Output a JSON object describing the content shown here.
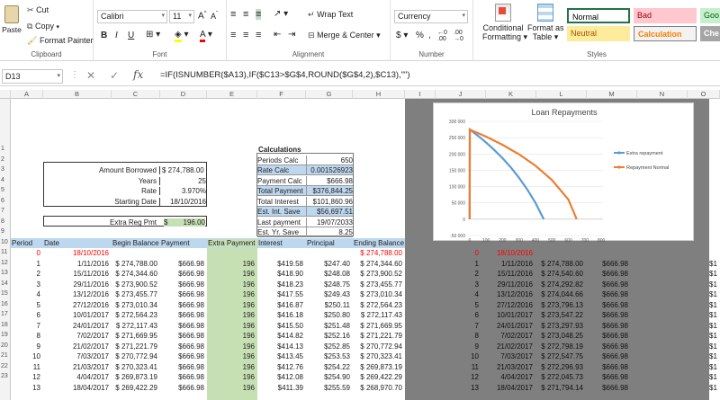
{
  "ribbon": {
    "clipboard": {
      "paste": "Paste",
      "cut": "Cut",
      "copy": "Copy",
      "format_painter": "Format Painter",
      "label": "Clipboard"
    },
    "font": {
      "name": "Calibri",
      "size": "11",
      "label": "Font"
    },
    "alignment": {
      "wrap": "Wrap Text",
      "merge": "Merge & Center",
      "label": "Alignment"
    },
    "number": {
      "format": "Currency",
      "label": "Number"
    },
    "styles": {
      "conditional": "Conditional",
      "conditional2": "Formatting",
      "format_as": "Format as",
      "format_as2": "Table",
      "normal": "Normal",
      "bad": "Bad",
      "good": "Goo",
      "neutral": "Neutral",
      "calculation": "Calculation",
      "check": "Che",
      "label": "Styles"
    }
  },
  "formula_bar": {
    "name_box": "D13",
    "formula": "=IF(ISNUMBER($A13),IF($C13>$G$4,ROUND($G$4,2),$C13),\"\")"
  },
  "columns": [
    "A",
    "B",
    "C",
    "D",
    "E",
    "F",
    "G",
    "H",
    "I",
    "J",
    "K",
    "L",
    "M",
    "N",
    "O"
  ],
  "rows": [
    "1",
    "2",
    "3",
    "4",
    "5",
    "6",
    "7",
    "8",
    "9",
    "10",
    "11",
    "12",
    "13",
    "14",
    "15",
    "16",
    "17",
    "18",
    "19",
    "20",
    "21",
    "22",
    "23"
  ],
  "inputs": [
    {
      "label": "Amount Borrowed",
      "value": "$ 274,788.00"
    },
    {
      "label": "Years",
      "value": "25"
    },
    {
      "label": "Rate",
      "value": "3.970%"
    },
    {
      "label": "Starting Date",
      "value": "18/10/2016"
    }
  ],
  "extra_reg_pmt": {
    "label": "Extra Reg Pmt",
    "currency": "$",
    "value": "196.00"
  },
  "calculations": {
    "title": "Calculations",
    "rows": [
      {
        "label": "Periods Calc",
        "value": "650"
      },
      {
        "label": "Rate Calc",
        "value": "0.001526923"
      },
      {
        "label": "Payment Calc",
        "value": "$666.98"
      },
      {
        "label": "Total Payment",
        "value": "$376,844.25"
      },
      {
        "label": "Total Interest",
        "value": "$101,860.96"
      },
      {
        "label": "Est. Int. Save",
        "value": "$56,697.51"
      },
      {
        "label": "Last payment",
        "value": "19/07/2033"
      },
      {
        "label": "Est. Yr. Save",
        "value": "8.25"
      }
    ]
  },
  "table_headers": [
    "Period",
    "Date",
    "Begin Balance",
    "Payment",
    "Extra Payment",
    "Interest",
    "Principal",
    "Ending Balance"
  ],
  "table": [
    [
      "0",
      "18/10/2016",
      "",
      "",
      "",
      "",
      "",
      "$ 274,788.00"
    ],
    [
      "1",
      "1/11/2016",
      "$ 274,788.00",
      "$666.98",
      "196",
      "$419.58",
      "$247.40",
      "$ 274,344.60"
    ],
    [
      "2",
      "15/11/2016",
      "$ 274,344.60",
      "$666.98",
      "196",
      "$418.90",
      "$248.08",
      "$ 273,900.52"
    ],
    [
      "3",
      "29/11/2016",
      "$ 273,900.52",
      "$666.98",
      "196",
      "$418.23",
      "$248.75",
      "$ 273,455.77"
    ],
    [
      "4",
      "13/12/2016",
      "$ 273,455.77",
      "$666.98",
      "196",
      "$417.55",
      "$249.43",
      "$ 273,010.34"
    ],
    [
      "5",
      "27/12/2016",
      "$ 273,010.34",
      "$666.98",
      "196",
      "$416.87",
      "$250.11",
      "$ 272,564.23"
    ],
    [
      "6",
      "10/01/2017",
      "$ 272,564.23",
      "$666.98",
      "196",
      "$416.18",
      "$250.80",
      "$ 272,117.43"
    ],
    [
      "7",
      "24/01/2017",
      "$ 272,117.43",
      "$666.98",
      "196",
      "$415.50",
      "$251.48",
      "$ 271,669.95"
    ],
    [
      "8",
      "7/02/2017",
      "$ 271,669.95",
      "$666.98",
      "196",
      "$414.82",
      "$252.16",
      "$ 271,221.79"
    ],
    [
      "9",
      "21/02/2017",
      "$ 271,221.79",
      "$666.98",
      "196",
      "$414.13",
      "$252.85",
      "$ 270,772.94"
    ],
    [
      "10",
      "7/03/2017",
      "$ 270,772.94",
      "$666.98",
      "196",
      "$413.45",
      "$253.53",
      "$ 270,323.41"
    ],
    [
      "11",
      "21/03/2017",
      "$ 270,323.41",
      "$666.98",
      "196",
      "$412.76",
      "$254.22",
      "$ 269,873.19"
    ],
    [
      "12",
      "4/04/2017",
      "$ 269,873.19",
      "$666.98",
      "196",
      "$412.08",
      "$254.90",
      "$ 269,422.29"
    ],
    [
      "13",
      "18/04/2017",
      "$ 269,422.29",
      "$666.98",
      "196",
      "$411.39",
      "$255.59",
      "$ 268,970.70"
    ]
  ],
  "table2": [
    [
      "0",
      "18/10/2016",
      "",
      ""
    ],
    [
      "1",
      "1/11/2016",
      "$ 274,788.00",
      "$666.98"
    ],
    [
      "2",
      "15/11/2016",
      "$ 274,540.60",
      "$666.98"
    ],
    [
      "3",
      "29/11/2016",
      "$ 274,292.82",
      "$666.98"
    ],
    [
      "4",
      "13/12/2016",
      "$ 274,044.66",
      "$666.98"
    ],
    [
      "5",
      "27/12/2016",
      "$ 273,796.13",
      "$666.98"
    ],
    [
      "6",
      "10/01/2017",
      "$ 273,547.22",
      "$666.98"
    ],
    [
      "7",
      "24/01/2017",
      "$ 273,297.93",
      "$666.98"
    ],
    [
      "8",
      "7/02/2017",
      "$ 273,048.25",
      "$666.98"
    ],
    [
      "9",
      "21/02/2017",
      "$ 272,798.19",
      "$666.98"
    ],
    [
      "10",
      "7/03/2017",
      "$ 272,547.75",
      "$666.98"
    ],
    [
      "11",
      "21/03/2017",
      "$ 272,296.93",
      "$666.98"
    ],
    [
      "12",
      "4/04/2017",
      "$ 272,045.73",
      "$666.98"
    ],
    [
      "13",
      "18/04/2017",
      "$ 271,794.14",
      "$666.98"
    ]
  ],
  "table2_extra": [
    "$1",
    "$1",
    "$1",
    "$1",
    "$1",
    "$1",
    "$1",
    "$1",
    "$1",
    "$1",
    "$1",
    "$1",
    "$1"
  ],
  "colors": {
    "accent_green": "#217346",
    "extra_fill": "#c6e0b4",
    "header_fill": "#bdd7ee",
    "calc_fill": "#ddebf7",
    "red": "#ff0000",
    "series_extra": "#5b9bd5",
    "series_normal": "#ed7d31"
  },
  "chart_data": {
    "type": "line",
    "title": "Loan Repayments",
    "xlim": [
      -10,
      810
    ],
    "ylim": [
      -50000,
      300000
    ],
    "x_ticks": [
      0,
      100,
      200,
      300,
      400,
      500,
      600,
      700,
      800
    ],
    "y_ticks": [
      -50000,
      0,
      50000,
      100000,
      150000,
      200000,
      250000,
      300000
    ],
    "x_tick_labels": [
      "0",
      "100",
      "200",
      "300",
      "400",
      "500",
      "600",
      "700",
      "800"
    ],
    "y_tick_labels": [
      "-50 000",
      "0",
      "50 000",
      "100 000",
      "150 000",
      "200 000",
      "250 000",
      "300 000"
    ],
    "legend_position": "right",
    "series": [
      {
        "name": "Extra repayment",
        "x": [
          0,
          1,
          50,
          100,
          150,
          200,
          250,
          300,
          350,
          400,
          450
        ],
        "y": [
          0,
          274788,
          256000,
          235000,
          212000,
          187000,
          159000,
          127000,
          91000,
          50000,
          0
        ]
      },
      {
        "name": "Repayment Normal",
        "x": [
          0,
          1,
          100,
          200,
          300,
          400,
          500,
          600,
          650
        ],
        "y": [
          0,
          274788,
          253000,
          228000,
          199000,
          164000,
          120000,
          60000,
          0
        ]
      }
    ]
  }
}
